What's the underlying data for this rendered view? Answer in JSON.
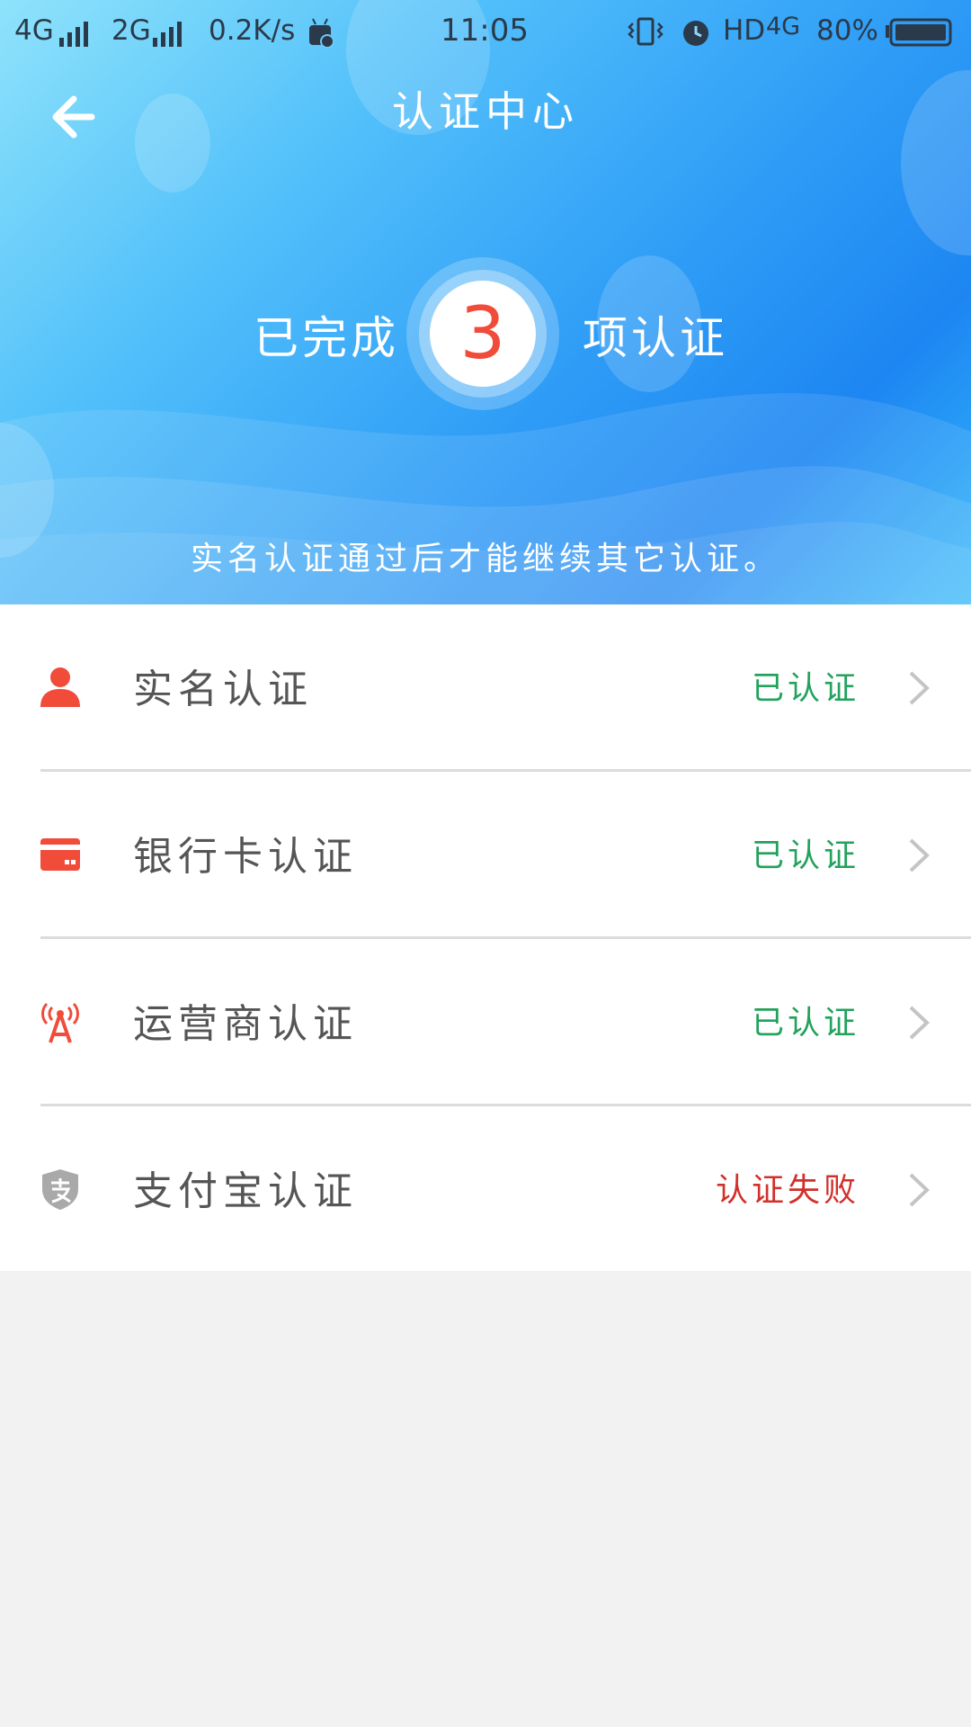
{
  "status_bar": {
    "network1": "4G",
    "network2": "2G",
    "speed": "0.2K/s",
    "time": "11:05",
    "hd": "HD",
    "net4g": "4G",
    "battery": "80%"
  },
  "header": {
    "title": "认证中心"
  },
  "summary": {
    "prefix": "已完成",
    "count": "3",
    "suffix": "项认证",
    "hint": "实名认证通过后才能继续其它认证。"
  },
  "colors": {
    "accent_red": "#f14b3a",
    "success_green": "#22a25c",
    "fail_red": "#d2302a",
    "shield_gray": "#a9a9a9"
  },
  "items": [
    {
      "label": "实名认证",
      "status": "已认证",
      "icon": "person-icon"
    },
    {
      "label": "银行卡认证",
      "status": "已认证",
      "icon": "bank-card-icon"
    },
    {
      "label": "运营商认证",
      "status": "已认证",
      "icon": "signal-tower-icon"
    },
    {
      "label": "支付宝认证",
      "status": "认证失败",
      "icon": "alipay-shield-icon"
    }
  ]
}
